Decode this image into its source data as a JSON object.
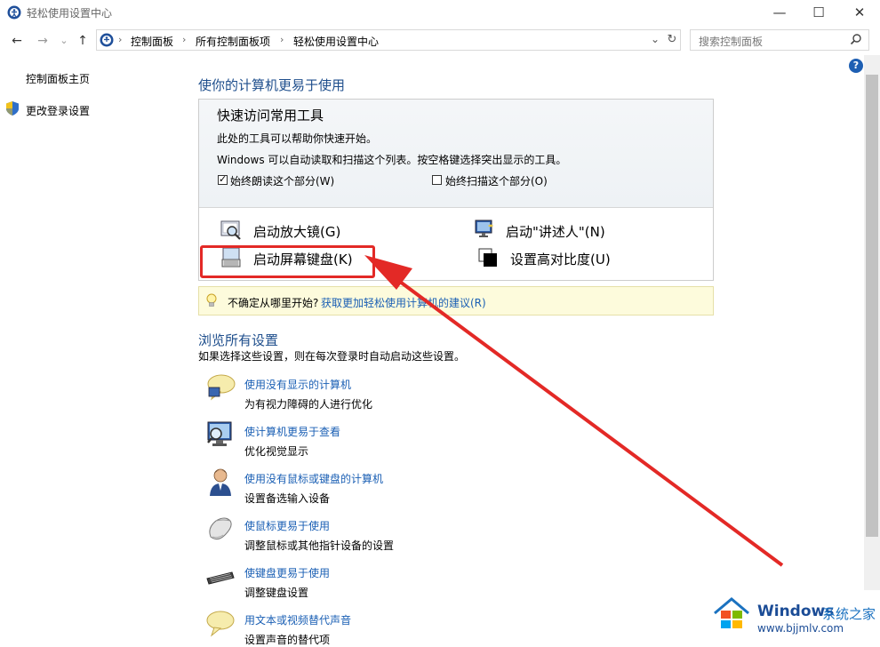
{
  "window": {
    "title": "轻松使用设置中心",
    "minimize": "—",
    "maximize": "☐",
    "close": "✕"
  },
  "address_bar": {
    "crumbs": [
      "控制面板",
      "所有控制面板项",
      "轻松使用设置中心"
    ],
    "separator": "›",
    "search_placeholder": "搜索控制面板"
  },
  "nav": {
    "back": "←",
    "forward": "→",
    "recent": "⌄",
    "up": "↑",
    "dropdown": "⌄",
    "refresh": "↻"
  },
  "sidebar": {
    "items": [
      {
        "label": "控制面板主页"
      },
      {
        "label": "更改登录设置"
      }
    ]
  },
  "help": "?",
  "main": {
    "heading": "使你的计算机更易于使用",
    "quick_access": {
      "title": "快速访问常用工具",
      "desc1": "此处的工具可以帮助你快速开始。",
      "desc2": "Windows 可以自动读取和扫描这个列表。按空格键选择突出显示的工具。",
      "checkbox_read": {
        "label": "始终朗读这个部分(W)",
        "checked": true,
        "mark": "✓"
      },
      "checkbox_scan": {
        "label": "始终扫描这个部分(O)",
        "checked": false
      },
      "tools": [
        {
          "label": "启动放大镜(G)",
          "icon": "magnifier-icon"
        },
        {
          "label": "启动\"讲述人\"(N)",
          "icon": "narrator-icon"
        },
        {
          "label": "启动屏幕键盘(K)",
          "icon": "onscreen-keyboard-icon"
        },
        {
          "label": "设置高对比度(U)",
          "icon": "high-contrast-icon"
        }
      ]
    },
    "tip": {
      "text": "不确定从哪里开始?",
      "link": "获取更加轻松使用计算机的建议(R)"
    },
    "browse": {
      "heading": "浏览所有设置",
      "desc": "如果选择这些设置，则在每次登录时自动启动这些设置。",
      "items": [
        {
          "link": "使用没有显示的计算机",
          "desc": "为有视力障碍的人进行优化",
          "icon": "speech-balloon-icon"
        },
        {
          "link": "使计算机更易于查看",
          "desc": "优化视觉显示",
          "icon": "monitor-magnifier-icon"
        },
        {
          "link": "使用没有鼠标或键盘的计算机",
          "desc": "设置备选输入设备",
          "icon": "user-icon"
        },
        {
          "link": "使鼠标更易于使用",
          "desc": "调整鼠标或其他指针设备的设置",
          "icon": "mouse-icon"
        },
        {
          "link": "使键盘更易于使用",
          "desc": "调整键盘设置",
          "icon": "keyboard-icon"
        },
        {
          "link": "用文本或视频替代声音",
          "desc": "设置声音的替代项",
          "icon": "speech-balloon-icon"
        }
      ]
    }
  },
  "annotation": {
    "color": "#e32926"
  },
  "watermark": {
    "brand": "Windows",
    "cn": "系统之家",
    "url": "www.bjjmlv.com"
  },
  "colors": {
    "link": "#1a5fb4",
    "heading": "#1e4e8c",
    "tip_bg": "#fdfbdc"
  }
}
